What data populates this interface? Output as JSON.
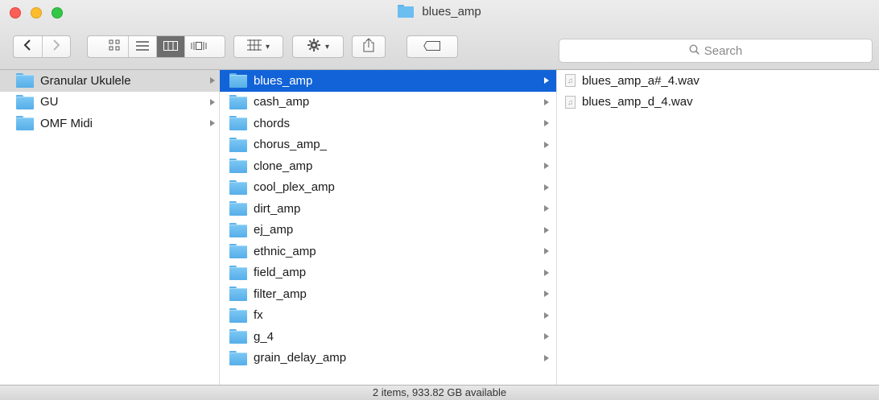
{
  "window": {
    "title": "blues_amp"
  },
  "toolbar": {
    "back_icon": "chevron-left-icon",
    "forward_icon": "chevron-right-icon",
    "view_modes": [
      "icon-view-icon",
      "list-view-icon",
      "column-view-icon",
      "cover-flow-icon"
    ],
    "active_view": "column-view-icon",
    "arrange_icon": "arrange-grid-icon",
    "action_icon": "gear-icon",
    "share_icon": "share-icon",
    "tag_icon": "tag-icon"
  },
  "search": {
    "placeholder": "Search"
  },
  "columns": {
    "col1": [
      {
        "label": "Granular Ukulele",
        "selected": true
      },
      {
        "label": "GU"
      },
      {
        "label": "OMF Midi"
      }
    ],
    "col2": [
      {
        "label": "blues_amp",
        "selected": true
      },
      {
        "label": "cash_amp"
      },
      {
        "label": "chords"
      },
      {
        "label": "chorus_amp_"
      },
      {
        "label": "clone_amp"
      },
      {
        "label": "cool_plex_amp"
      },
      {
        "label": "dirt_amp"
      },
      {
        "label": "ej_amp"
      },
      {
        "label": "ethnic_amp"
      },
      {
        "label": "field_amp"
      },
      {
        "label": "filter_amp"
      },
      {
        "label": "fx"
      },
      {
        "label": "g_4"
      },
      {
        "label": "grain_delay_amp"
      }
    ],
    "col3": [
      {
        "label": "blues_amp_a#_4.wav"
      },
      {
        "label": "blues_amp_d_4.wav"
      }
    ]
  },
  "status": {
    "text": "2 items, 933.82 GB available"
  },
  "colors": {
    "selection_blue": "#1263d8",
    "selection_gray": "#d9d9d9",
    "folder_blue": "#5fb1e8"
  }
}
